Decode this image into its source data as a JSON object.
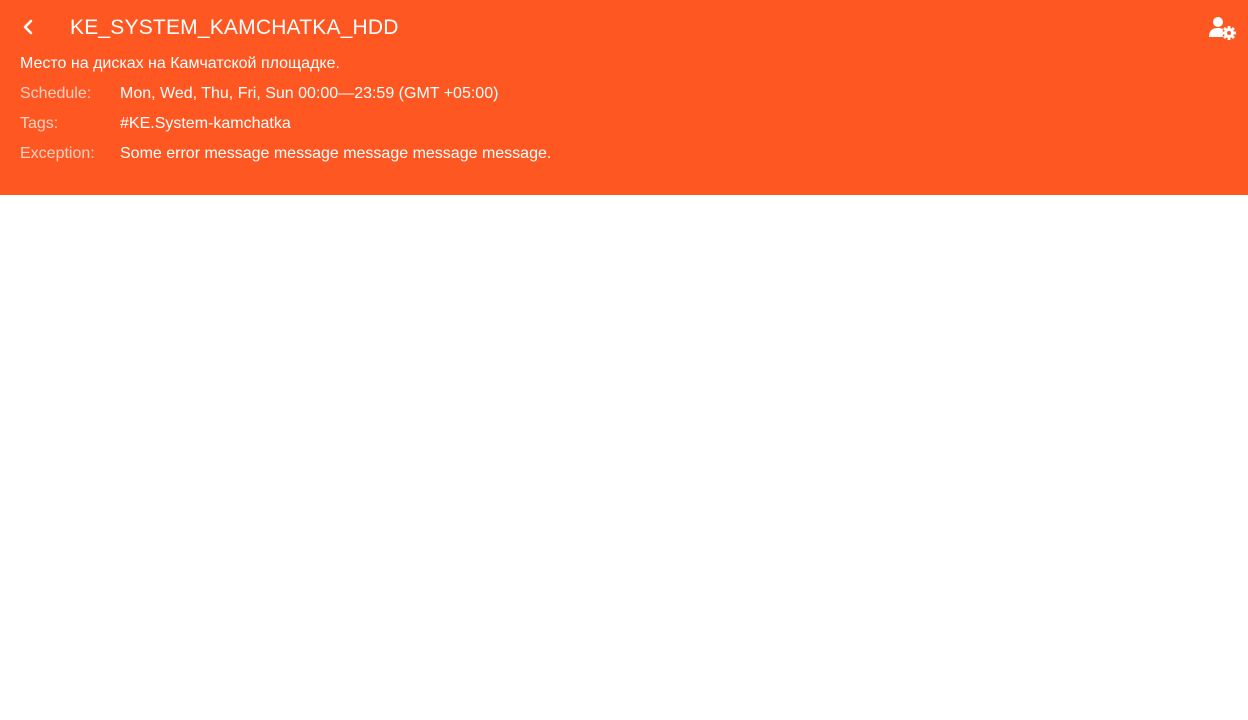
{
  "header": {
    "title": "KE_SYSTEM_KAMCHATKA_HDD",
    "description": "Место на дисках на Камчатской площадке.",
    "background_color": "#ff5722",
    "back_icon": "chevron-left-icon",
    "settings_icon": "user-settings-icon"
  },
  "fields": {
    "schedule": {
      "label": "Schedule:",
      "value": "Mon, Wed, Thu, Fri, Sun 00:00—23:59 (GMT +05:00)"
    },
    "tags": {
      "label": "Tags:",
      "value": "#KE.System-kamchatka"
    },
    "exception": {
      "label": "Exception:",
      "value": "Some error message message message message message."
    }
  }
}
